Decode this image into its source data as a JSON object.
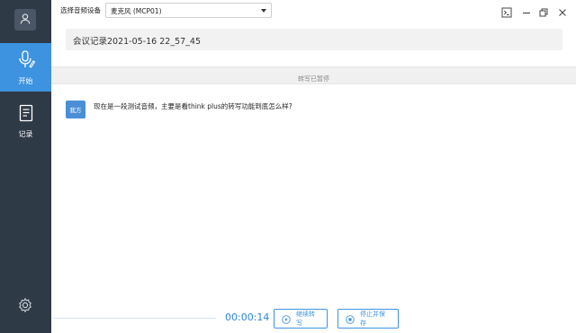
{
  "sidebar": {
    "avatar_icon": "user-icon",
    "items": [
      {
        "label": "开始",
        "icon": "microphone-pen-icon",
        "active": true
      },
      {
        "label": "记录",
        "icon": "notebook-icon",
        "active": false
      }
    ],
    "settings_icon": "gear-icon"
  },
  "topbar": {
    "device_label": "选择音频设备",
    "device_value": "麦克风 (MCP01)"
  },
  "window_controls": [
    "terminal-icon",
    "minimize-icon",
    "restore-icon",
    "close-icon"
  ],
  "meeting": {
    "title": "会议记录2021-05-16 22_57_45"
  },
  "status": {
    "text": "转写已暂停"
  },
  "transcript": [
    {
      "speaker": "我方",
      "text": "现在是一段测试音频，主要是看think plus的转写功能到底怎么样?"
    }
  ],
  "controls": {
    "timer": "00:00:14",
    "continue_label": "继续转写",
    "stop_label": "停止并保存"
  },
  "colors": {
    "sidebar_bg": "#2f3a47",
    "accent": "#3d93e0"
  }
}
